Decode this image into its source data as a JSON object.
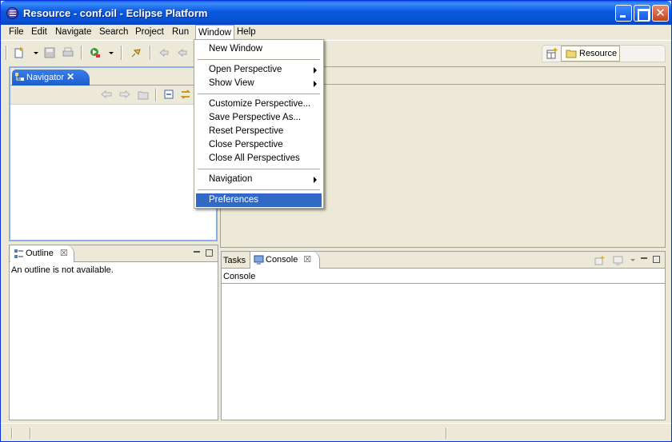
{
  "window": {
    "title": "Resource - conf.oil - Eclipse Platform"
  },
  "menubar": {
    "items": [
      "File",
      "Edit",
      "Navigate",
      "Search",
      "Project",
      "Run",
      "Window",
      "Help"
    ]
  },
  "window_menu": {
    "items": [
      {
        "label": "New Window",
        "submenu": false
      },
      {
        "label": "Open Perspective",
        "submenu": true
      },
      {
        "label": "Show View",
        "submenu": true
      },
      {
        "label": "Customize Perspective...",
        "submenu": false
      },
      {
        "label": "Save Perspective As...",
        "submenu": false
      },
      {
        "label": "Reset Perspective",
        "submenu": false
      },
      {
        "label": "Close Perspective",
        "submenu": false
      },
      {
        "label": "Close All Perspectives",
        "submenu": false
      },
      {
        "label": "Navigation",
        "submenu": true
      },
      {
        "label": "Preferences",
        "submenu": false,
        "selected": true
      }
    ]
  },
  "perspective": {
    "label": "Resource"
  },
  "navigator": {
    "tab_label": "Navigator",
    "close_glyph": "✕"
  },
  "outline": {
    "tab_label": "Outline",
    "message": "An outline is not available.",
    "close_glyph": "☒"
  },
  "console_panel": {
    "tabs": [
      "Tasks",
      "Console"
    ],
    "close_glyph": "☒",
    "header": "Console"
  },
  "colors": {
    "title_bar": "#0b59e0",
    "menu_selection": "#316ac5",
    "active_tab": "#1b5fcf"
  }
}
